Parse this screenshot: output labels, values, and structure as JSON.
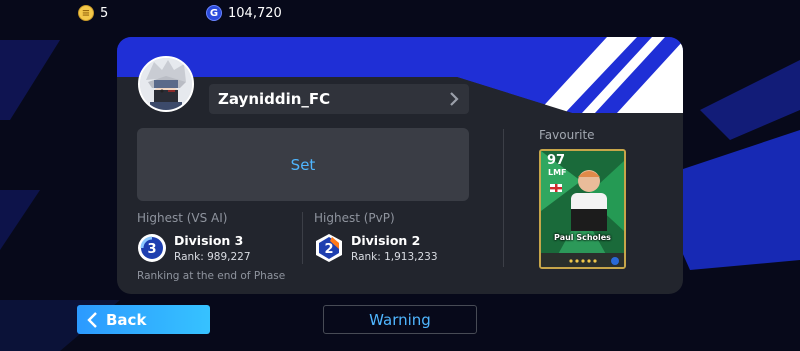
{
  "topbar": {
    "coins": {
      "icon": "coin-icon",
      "value": "5"
    },
    "gp": {
      "icon": "gp-icon",
      "glyph": "G",
      "value": "104,720"
    }
  },
  "profile": {
    "username": "Zayniddin_FC",
    "set_label": "Set",
    "highest_vs_ai": {
      "label": "Highest (VS AI)",
      "division": "Division 3",
      "badge_number": "3",
      "rank": "Rank: 989,227"
    },
    "highest_pvp": {
      "label": "Highest (PvP)",
      "division": "Division 2",
      "badge_number": "2",
      "rank": "Rank: 1,913,233"
    },
    "note": "Ranking at the end of Phase",
    "favourite": {
      "label": "Favourite",
      "rating": "97",
      "position": "LMF",
      "player_name": "Paul Scholes"
    }
  },
  "buttons": {
    "back_label": "Back",
    "warning_label": "Warning"
  },
  "colors": {
    "accent_blue": "#4fb6ff",
    "header_blue": "#1f2fd6",
    "card_bg": "#22252d"
  }
}
